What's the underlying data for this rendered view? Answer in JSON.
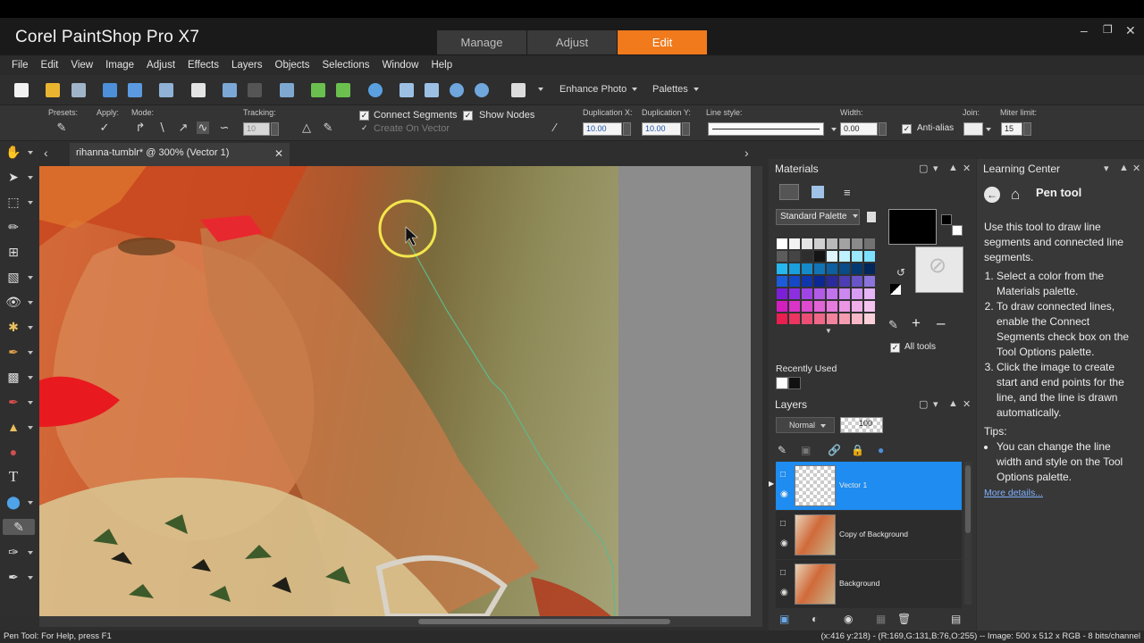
{
  "app": {
    "title": "Corel PaintShop Pro X7",
    "tabs": [
      "Manage",
      "Adjust",
      "Edit"
    ],
    "active_tab": "Edit"
  },
  "menu": [
    "File",
    "Edit",
    "View",
    "Image",
    "Adjust",
    "Effects",
    "Layers",
    "Objects",
    "Selections",
    "Window",
    "Help"
  ],
  "toolbar": {
    "enhance_photo": "Enhance Photo",
    "palettes": "Palettes"
  },
  "tool_options": {
    "presets_label": "Presets:",
    "apply_label": "Apply:",
    "mode_label": "Mode:",
    "tracking_label": "Tracking:",
    "tracking_value": "10",
    "connect_segments": "Connect Segments",
    "connect_segments_checked": true,
    "show_nodes": "Show Nodes",
    "show_nodes_checked": true,
    "create_on_vector": "Create On Vector",
    "duplication_x_label": "Duplication X:",
    "duplication_x": "10.00",
    "duplication_y_label": "Duplication Y:",
    "duplication_y": "10.00",
    "line_style_label": "Line style:",
    "width_label": "Width:",
    "width_value": "0.00",
    "anti_alias": "Anti-alias",
    "anti_alias_checked": true,
    "join_label": "Join:",
    "miter_limit_label": "Miter limit:",
    "miter_limit": "15"
  },
  "document": {
    "tab_title": "rihanna-tumblr* @ 300% (Vector 1)"
  },
  "materials": {
    "title": "Materials",
    "palette_select": "Standard Palette",
    "recently_used": "Recently Used",
    "all_tools": "All tools",
    "all_tools_checked": true,
    "foreground_color": "#000000",
    "swatches": [
      "#ffffff",
      "#f3f3f3",
      "#e4e4e4",
      "#d0d0d0",
      "#b9b9b9",
      "#a2a2a2",
      "#8a8a8a",
      "#727272",
      "#5c5c5c",
      "#454545",
      "#2e2e2e",
      "#151515",
      "#dff6ff",
      "#bff0ff",
      "#9be8ff",
      "#7ee0ff",
      "#26b7ee",
      "#1aa0dd",
      "#158acb",
      "#1074b5",
      "#0e5f9f",
      "#0a4b88",
      "#063872",
      "#03265b",
      "#1c5bd9",
      "#1548c4",
      "#1036ab",
      "#0b2893",
      "#2a2a9c",
      "#4d3db4",
      "#6a55c8",
      "#8b74dc",
      "#7b1fd8",
      "#8c2fe0",
      "#9f45e6",
      "#b35be9",
      "#c173ee",
      "#cc87f0",
      "#d99cf4",
      "#e6b6f6",
      "#d41fbf",
      "#d934c7",
      "#de4bce",
      "#e364d6",
      "#e87cde",
      "#ec96e4",
      "#f1afe9",
      "#f4c4ef",
      "#e81f4f",
      "#ea3660",
      "#ec4f73",
      "#ef6887",
      "#f2839c",
      "#f59cb1",
      "#f8b6c6",
      "#fad0db"
    ],
    "recent": [
      "#ffffff",
      "#111111"
    ]
  },
  "layers": {
    "title": "Layers",
    "blend_mode": "Normal",
    "opacity": "100",
    "items": [
      {
        "name": "Vector 1",
        "selected": true
      },
      {
        "name": "Copy of Background",
        "selected": false
      },
      {
        "name": "Background",
        "selected": false
      }
    ]
  },
  "learning_center": {
    "title": "Learning Center",
    "tool_name": "Pen tool",
    "intro": "Use this tool to draw line segments and connected line segments.",
    "steps": [
      "Select a color from the Materials palette.",
      "To draw connected lines, enable the Connect Segments check box on the Tool Options palette.",
      "Click the image to create start and end points for the line, and the line is drawn automatically."
    ],
    "tips_label": "Tips:",
    "tips": [
      "You can change the line width and style on the Tool Options palette."
    ],
    "more_details": "More details..."
  },
  "status": {
    "left": "Pen Tool: For Help, press F1",
    "right": "(x:416 y:218) - (R:169,G:131,B:76,O:255) -- Image:  500 x 512 x RGB - 8 bits/channel"
  }
}
